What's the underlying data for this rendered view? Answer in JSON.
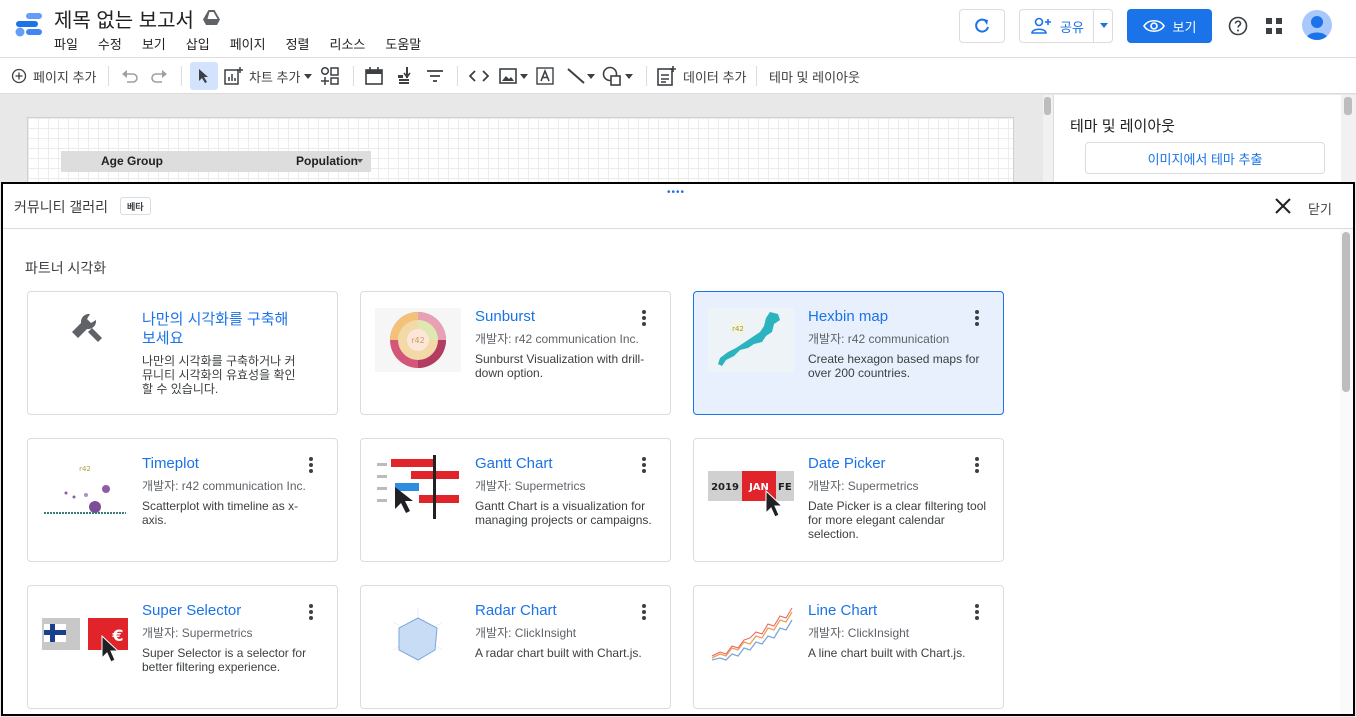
{
  "header": {
    "title": "제목 없는 보고서",
    "menu": [
      "파일",
      "수정",
      "보기",
      "삽입",
      "페이지",
      "정렬",
      "리소스",
      "도움말"
    ],
    "share_label": "공유",
    "view_label": "보기",
    "accent_color": "#1a73e8"
  },
  "toolbar": {
    "add_page_label": "페이지 추가",
    "add_chart_label": "차트 추가",
    "add_data_label": "데이터 추가",
    "theme_layout_label": "테마 및 레이아웃"
  },
  "canvas": {
    "table_headers": [
      "Age Group",
      "Population"
    ]
  },
  "right_panel": {
    "title": "테마 및 레이아웃",
    "extract_theme_label": "이미지에서 테마 추출"
  },
  "gallery": {
    "title": "커뮤니티 갤러리",
    "beta_label": "베타",
    "close_label": "닫기",
    "section_title": "파트너 시각화",
    "cards": [
      {
        "title": "나만의 시각화를 구축해 보세요",
        "developer": "",
        "description": "나만의 시각화를 구축하거나 커뮤니티 시각화의 유효성을 확인할 수 있습니다.",
        "icon": "wrench-icon"
      },
      {
        "title": "Sunburst",
        "developer": "개발자: r42 communication Inc.",
        "description": "Sunburst Visualization with drill-down option.",
        "icon": "sunburst-thumbnail"
      },
      {
        "title": "Hexbin map",
        "developer": "개발자: r42 communication",
        "description": "Create hexagon based maps for over 200 countries.",
        "icon": "hexbin-map-thumbnail"
      },
      {
        "title": "Timeplot",
        "developer": "개발자: r42 communication Inc.",
        "description": "Scatterplot with timeline as x-axis.",
        "icon": "timeplot-thumbnail"
      },
      {
        "title": "Gantt Chart",
        "developer": "개발자: Supermetrics",
        "description": "Gantt Chart is a visualization for managing projects or campaigns.",
        "icon": "gantt-thumbnail"
      },
      {
        "title": "Date Picker",
        "developer": "개발자: Supermetrics",
        "description": "Date Picker is a clear filtering tool for more elegant calendar selection.",
        "icon": "date-picker-thumbnail"
      },
      {
        "title": "Super Selector",
        "developer": "개발자: Supermetrics",
        "description": "Super Selector is a selector for better filtering experience.",
        "icon": "super-selector-thumbnail"
      },
      {
        "title": "Radar Chart",
        "developer": "개발자: ClickInsight",
        "description": "A radar chart built with Chart.js.",
        "icon": "radar-thumbnail"
      },
      {
        "title": "Line Chart",
        "developer": "개발자: ClickInsight",
        "description": "A line chart built with Chart.js.",
        "icon": "line-chart-thumbnail"
      }
    ],
    "thumbnail_text": {
      "r42": "r42",
      "year": "2019",
      "month": "JAN",
      "month_next": "FE",
      "currency": "€"
    }
  }
}
